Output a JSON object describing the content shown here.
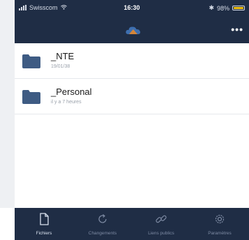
{
  "status_bar": {
    "carrier": "Swisscom",
    "time": "16:30",
    "battery_text": "98%",
    "battery_level": 0.98,
    "bluetooth_symbol": "✱"
  },
  "nav_bar": {
    "logo_icon": "cloud-logo-icon",
    "more_label": "•••"
  },
  "items": [
    {
      "title": "_NTE",
      "subtitle": "19/01/38",
      "icon": "folder-icon"
    },
    {
      "title": "_Personal",
      "subtitle": "il y a 7 heures",
      "icon": "folder-icon"
    }
  ],
  "tabs": [
    {
      "label": "Fichiers",
      "icon": "document-icon",
      "active": true
    },
    {
      "label": "Changements",
      "icon": "refresh-icon",
      "active": false
    },
    {
      "label": "Liens publics",
      "icon": "link-icon",
      "active": false
    },
    {
      "label": "Paramètres",
      "icon": "gear-icon",
      "active": false
    }
  ],
  "colors": {
    "bar_bg": "#1f2d45",
    "folder": "#3e5b83",
    "battery": "#f2c10f",
    "active_tab": "#d9e2ef",
    "inactive_tab": "#7d8aa3"
  }
}
